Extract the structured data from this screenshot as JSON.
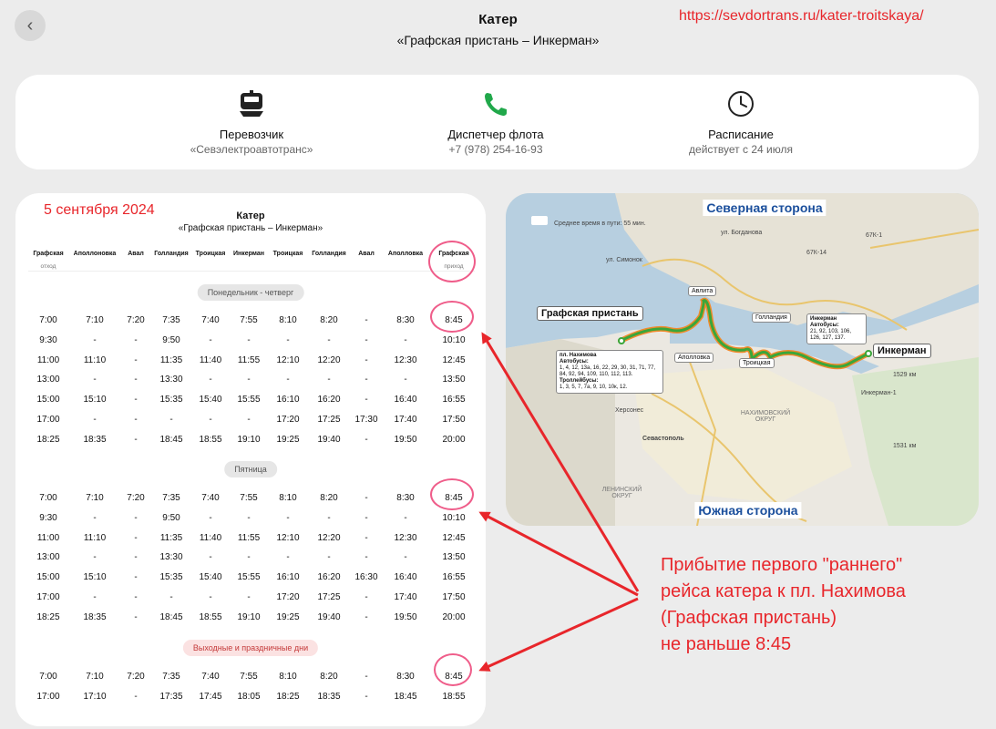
{
  "header": {
    "back_icon": "chevron-left-icon",
    "title": "Катер",
    "subtitle": "«Графская пристань – Инкерман»"
  },
  "annotations": {
    "url": "https://sevdortrans.ru/kater-troitskaya/",
    "date": "5 сентября 2024",
    "note_lines": [
      "Прибытие первого \"раннего\"",
      "рейса катера к пл. Нахимова",
      "(Графская пристань)",
      "не раньше 8:45"
    ],
    "color": "#e8262b"
  },
  "info": {
    "carrier": {
      "icon": "ferry-icon",
      "label": "Перевозчик",
      "value": "«Севэлектроавтотранс»"
    },
    "dispatcher": {
      "icon": "phone-icon",
      "label": "Диспетчер флота",
      "value": "+7 (978) 254-16-93"
    },
    "schedule": {
      "icon": "clock-icon",
      "label": "Расписание",
      "value": "действует с 24 июля"
    }
  },
  "timetable": {
    "title": "Катер",
    "subtitle": "«Графская пристань – Инкерман»",
    "columns": [
      "Графская",
      "Аполлоновка",
      "Авал",
      "Голландия",
      "Троицкая",
      "Инкерман",
      "Троицкая",
      "Голландия",
      "Авал",
      "Аполловка",
      "Графская"
    ],
    "first_col_sub": "отход",
    "last_col_sub": "приход",
    "sections": [
      {
        "name": "Понедельник - четверг",
        "style": "grey",
        "rows": [
          [
            "7:00",
            "7:10",
            "7:20",
            "7:35",
            "7:40",
            "7:55",
            "8:10",
            "8:20",
            "-",
            "8:30",
            "8:45"
          ],
          [
            "9:30",
            "-",
            "-",
            "9:50",
            "-",
            "-",
            "-",
            "-",
            "-",
            "-",
            "10:10"
          ],
          [
            "11:00",
            "11:10",
            "-",
            "11:35",
            "11:40",
            "11:55",
            "12:10",
            "12:20",
            "-",
            "12:30",
            "12:45"
          ],
          [
            "13:00",
            "-",
            "-",
            "13:30",
            "-",
            "-",
            "-",
            "-",
            "-",
            "-",
            "13:50"
          ],
          [
            "15:00",
            "15:10",
            "-",
            "15:35",
            "15:40",
            "15:55",
            "16:10",
            "16:20",
            "-",
            "16:40",
            "16:55"
          ],
          [
            "17:00",
            "-",
            "-",
            "-",
            "-",
            "-",
            "17:20",
            "17:25",
            "17:30",
            "17:40",
            "17:50"
          ],
          [
            "18:25",
            "18:35",
            "-",
            "18:45",
            "18:55",
            "19:10",
            "19:25",
            "19:40",
            "-",
            "19:50",
            "20:00"
          ]
        ]
      },
      {
        "name": "Пятница",
        "style": "grey",
        "rows": [
          [
            "7:00",
            "7:10",
            "7:20",
            "7:35",
            "7:40",
            "7:55",
            "8:10",
            "8:20",
            "-",
            "8:30",
            "8:45"
          ],
          [
            "9:30",
            "-",
            "-",
            "9:50",
            "-",
            "-",
            "-",
            "-",
            "-",
            "-",
            "10:10"
          ],
          [
            "11:00",
            "11:10",
            "-",
            "11:35",
            "11:40",
            "11:55",
            "12:10",
            "12:20",
            "-",
            "12:30",
            "12:45"
          ],
          [
            "13:00",
            "-",
            "-",
            "13:30",
            "-",
            "-",
            "-",
            "-",
            "-",
            "-",
            "13:50"
          ],
          [
            "15:00",
            "15:10",
            "-",
            "15:35",
            "15:40",
            "15:55",
            "16:10",
            "16:20",
            "16:30",
            "16:40",
            "16:55"
          ],
          [
            "17:00",
            "-",
            "-",
            "-",
            "-",
            "-",
            "17:20",
            "17:25",
            "-",
            "17:40",
            "17:50"
          ],
          [
            "18:25",
            "18:35",
            "-",
            "18:45",
            "18:55",
            "19:10",
            "19:25",
            "19:40",
            "-",
            "19:50",
            "20:00"
          ]
        ]
      },
      {
        "name": "Выходные и праздничные дни",
        "style": "red",
        "rows": [
          [
            "7:00",
            "7:10",
            "7:20",
            "7:35",
            "7:40",
            "7:55",
            "8:10",
            "8:20",
            "-",
            "8:30",
            "8:45"
          ],
          [
            "17:00",
            "17:10",
            "-",
            "17:35",
            "17:45",
            "18:05",
            "18:25",
            "18:35",
            "-",
            "18:45",
            "18:55"
          ]
        ]
      }
    ]
  },
  "map": {
    "north_label": "Северная сторона",
    "south_label": "Южная сторона",
    "travel_time": "Среднее время в пути: 55 мин.",
    "stop_start": "Графская пристань",
    "stop_end": "Инкерман",
    "stops": [
      "Авлита",
      "Голландия",
      "Аполловка",
      "Троицкая"
    ],
    "nakhimov_box": {
      "title": "пл. Нахимова",
      "bus_label": "Автобусы:",
      "buses": "1, 4, 12, 13а, 16, 22, 29, 30, 31, 71, 77, 84, 92, 94, 109, 110, 112, 113.",
      "trolley_label": "Троллейбусы:",
      "trolleys": "1, 3, 5, 7, 7а, 9, 10, 10к, 12."
    },
    "inkerman_box": {
      "title": "Инкерман",
      "bus_label": "Автобусы:",
      "buses": "21, 92, 103, 106, 126, 127, 137."
    },
    "districts": [
      "НАХИМОВСКИЙ ОКРУГ",
      "ЛЕНИНСКИЙ ОКРУГ"
    ],
    "places": [
      "Севастополь",
      "Инкерман-1",
      "ул. Симонок",
      "ул. Богданова",
      "Херсонес"
    ],
    "roads": [
      "67К-14",
      "67К-1"
    ],
    "distances": [
      "1529 км",
      "1531 км"
    ],
    "route_color": "#3aa63a",
    "route_edge_color": "#f08a2c",
    "water_color": "#b7cfe0",
    "label_color": "#1b4f9c"
  }
}
